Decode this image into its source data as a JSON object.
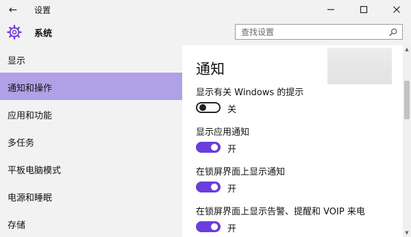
{
  "window": {
    "title": "设置"
  },
  "header": {
    "app_title": "系统"
  },
  "search": {
    "placeholder": "查找设置"
  },
  "sidebar": {
    "items": [
      {
        "label": "显示",
        "selected": false
      },
      {
        "label": "通知和操作",
        "selected": true
      },
      {
        "label": "应用和功能",
        "selected": false
      },
      {
        "label": "多任务",
        "selected": false
      },
      {
        "label": "平板电脑模式",
        "selected": false
      },
      {
        "label": "电源和睡眠",
        "selected": false
      },
      {
        "label": "存储",
        "selected": false
      }
    ]
  },
  "main": {
    "title": "通知",
    "options": [
      {
        "label": "显示有关 Windows 的提示",
        "state": "关",
        "on": false
      },
      {
        "label": "显示应用通知",
        "state": "开",
        "on": true
      },
      {
        "label": "在锁屏界面上显示通知",
        "state": "开",
        "on": true
      },
      {
        "label": "在锁屏界面上显示告警、提醒和 VOIP 来电",
        "state": "开",
        "on": true
      }
    ]
  },
  "colors": {
    "accent": "#6b3ddc",
    "selection": "#b0a1e6",
    "chrome": "#f2f2f2"
  },
  "icons": [
    "back-arrow-icon",
    "minimize-icon",
    "maximize-icon",
    "close-icon",
    "gear-icon",
    "search-icon"
  ]
}
